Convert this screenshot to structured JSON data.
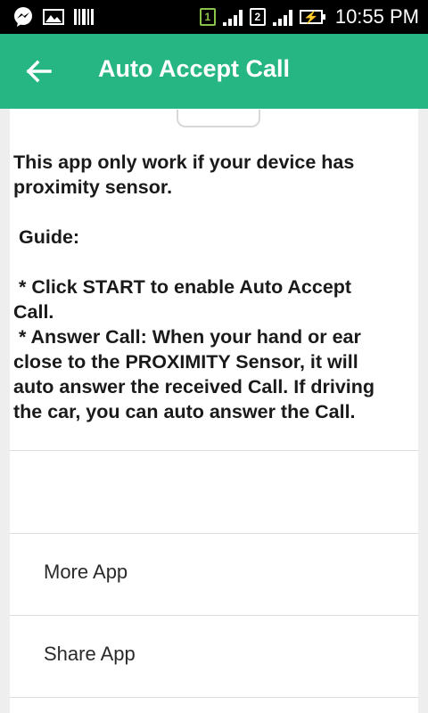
{
  "status_bar": {
    "left_icons": [
      "messenger-icon",
      "gallery-icon",
      "barcode-icon"
    ],
    "sim1_label": "1",
    "sim2_label": "2",
    "time": "10:55 PM",
    "battery_state": "charging",
    "sim1_color": "#8bc34a"
  },
  "app_bar": {
    "title": "Auto Accept Call",
    "back_icon": "arrow-back-icon",
    "color": "#26b683"
  },
  "description": "This app only work if your device has proximity sensor.\n\n Guide:\n\n * Click START to enable Auto Accept Call.\n * Answer Call: When your hand or ear close to the PROXIMITY Sensor, it will auto answer the received Call. If driving the car, you can auto answer the Call.",
  "menu": {
    "more_app": "More App",
    "share_app": "Share App"
  }
}
